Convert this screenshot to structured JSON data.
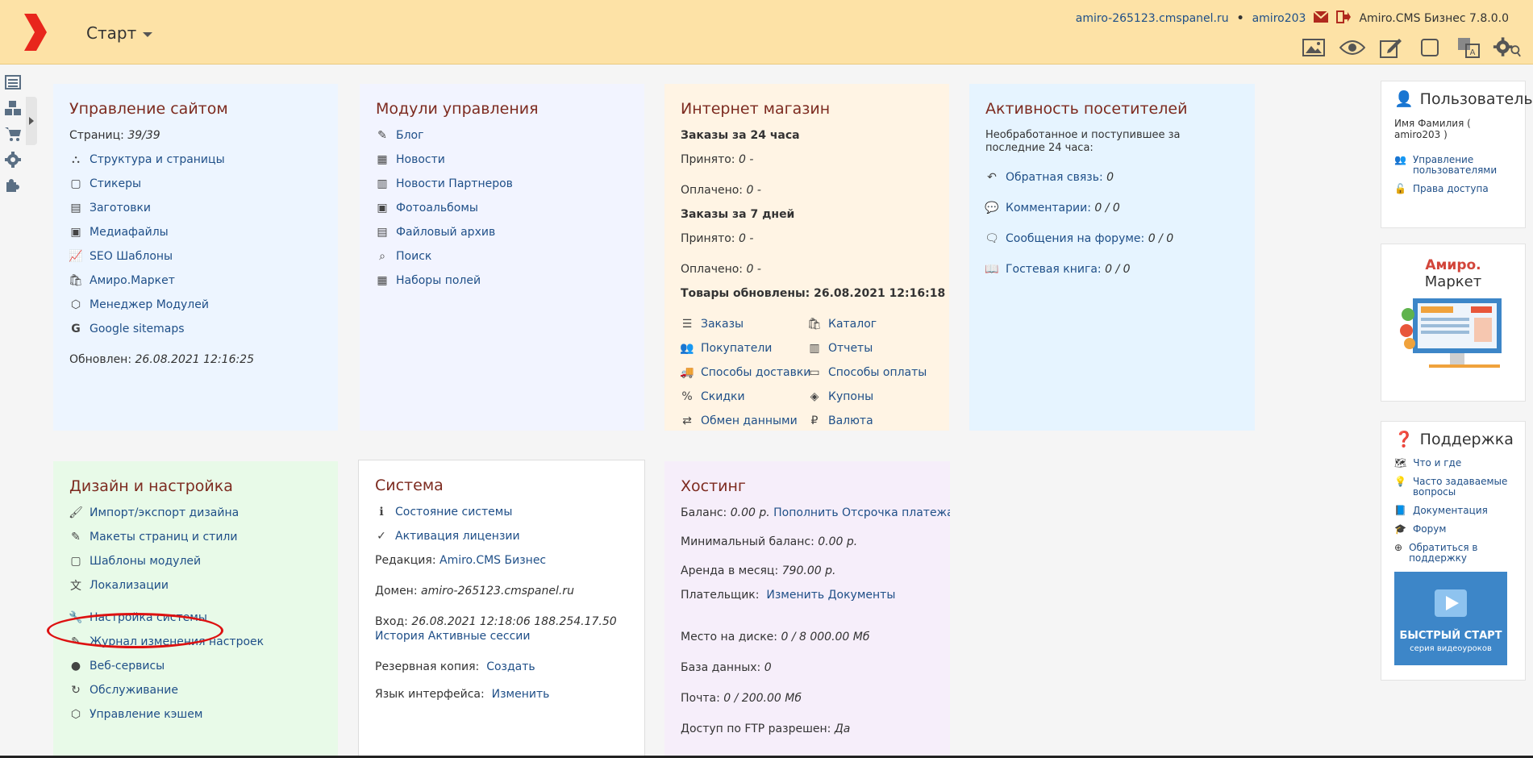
{
  "header": {
    "start_label": "Старт",
    "domain": "amiro-265123.cmspanel.ru",
    "bullet": "•",
    "user": "amiro203",
    "version": "Amiro.CMS Бизнес 7.8.0.0"
  },
  "site": {
    "title": "Управление сайтом",
    "pages_label": "Страниц:",
    "pages_value": "39/39",
    "links": [
      "Структура и страницы",
      "Стикеры",
      "Заготовки",
      "Медиафайлы",
      "SEO Шаблоны",
      "Амиро.Маркет",
      "Менеджер Модулей",
      "Google sitemaps"
    ],
    "updated_label": "Обновлен:",
    "updated_value": "26.08.2021 12:16:25"
  },
  "modules": {
    "title": "Модули управления",
    "links": [
      "Блог",
      "Новости",
      "Новости Партнеров",
      "Фотоальбомы",
      "Файловый архив",
      "Поиск",
      "Наборы полей"
    ]
  },
  "shop": {
    "title": "Интернет магазин",
    "orders24": "Заказы за 24 часа",
    "orders7": "Заказы за 7 дней",
    "accepted": "Принято:",
    "paid": "Оплачено:",
    "zero": "0 -",
    "goods_updated": "Товары обновлены: 26.08.2021 12:16:18",
    "links": [
      "Заказы",
      "Каталог",
      "Покупатели",
      "Отчеты",
      "Способы доставки",
      "Способы оплаты",
      "Скидки",
      "Купоны",
      "Обмен данными",
      "Валюта"
    ]
  },
  "activity": {
    "title": "Активность посетителей",
    "desc": "Необработанное и поступившее за последние 24 часа:",
    "items": [
      {
        "label": "Обратная связь:",
        "value": "0"
      },
      {
        "label": "Комментарии:",
        "value": "0 / 0"
      },
      {
        "label": "Сообщения на форуме:",
        "value": "0 / 0"
      },
      {
        "label": "Гостевая книга:",
        "value": "0 / 0"
      }
    ]
  },
  "design": {
    "title": "Дизайн и настройка",
    "links": [
      "Импорт/экспорт дизайна",
      "Макеты страниц и стили",
      "Шаблоны модулей",
      "Локализации",
      "Настройка системы",
      "Журнал изменения настроек",
      "Веб-сервисы",
      "Обслуживание",
      "Управление кэшем"
    ]
  },
  "system": {
    "title": "Система",
    "links": [
      "Состояние системы",
      "Активация лицензии"
    ],
    "edition_label": "Редакция:",
    "edition_value": "Amiro.CMS Бизнес",
    "domain_label": "Домен:",
    "domain_value": "amiro-265123.cmspanel.ru",
    "login_label": "Вход:",
    "login_value": "26.08.2021 12:18:06 188.254.17.50",
    "history": "История",
    "active_sessions": "Активные сессии",
    "backup_label": "Резервная копия:",
    "backup_link": "Создать",
    "lang_label": "Язык интерфейса:",
    "lang_link": "Изменить"
  },
  "hosting": {
    "title": "Хостинг",
    "balance_label": "Баланс:",
    "balance_value": "0.00 р.",
    "topup": "Пополнить",
    "deferral": "Отсрочка платежа",
    "minbal_label": "Минимальный баланс:",
    "minbal_value": "0.00 р.",
    "rent_label": "Аренда в месяц:",
    "rent_value": "790.00 р.",
    "payer_label": "Плательщик:",
    "payer_change": "Изменить",
    "payer_docs": "Документы",
    "disk_label": "Место на диске:",
    "disk_value": "0 / 8 000.00 Мб",
    "db_label": "База данных:",
    "db_value": "0",
    "mail_label": "Почта:",
    "mail_value": "0 / 200.00 Мб",
    "ftp_label": "Доступ по FTP разрешен:",
    "ftp_value": "Да"
  },
  "user_box": {
    "title": "Пользователь",
    "name": "Имя Фамилия ( amiro203 )",
    "manage": "Управление пользователями",
    "rights": "Права доступа"
  },
  "market_box": {
    "brand": "Амиро.",
    "name": "Маркет"
  },
  "support_box": {
    "title": "Поддержка",
    "links": [
      "Что и где",
      "Часто задаваемые вопросы",
      "Документация",
      "Форум",
      "Обратиться в поддержку"
    ],
    "video_title": "БЫСТРЫЙ СТАРТ",
    "video_sub": "серия видеоуроков"
  },
  "colors": {
    "accent": "#7d2b20",
    "link": "#1f4f88",
    "header_bg": "#fde2a6",
    "logo_red": "#e8261c",
    "highlight": "#d11111"
  },
  "icons": [
    "site-tree-icon",
    "sticker-icon",
    "blank-icon",
    "media-icon",
    "seo-icon",
    "market-icon",
    "modules-icon",
    "google-icon",
    "blog-icon",
    "news-icon",
    "search-icon",
    "fields-icon",
    "orders-icon",
    "catalog-icon",
    "buyers-icon",
    "reports-icon",
    "delivery-icon",
    "payment-icon",
    "discount-icon",
    "coupon-icon",
    "exchange-icon",
    "currency-icon",
    "feedback-icon",
    "comment-icon",
    "forum-icon",
    "guestbook-icon",
    "brush-icon",
    "wrench-icon",
    "globe-icon",
    "refresh-icon",
    "cache-icon",
    "info-icon",
    "check-icon",
    "user-icon",
    "help-icon",
    "play-icon"
  ]
}
